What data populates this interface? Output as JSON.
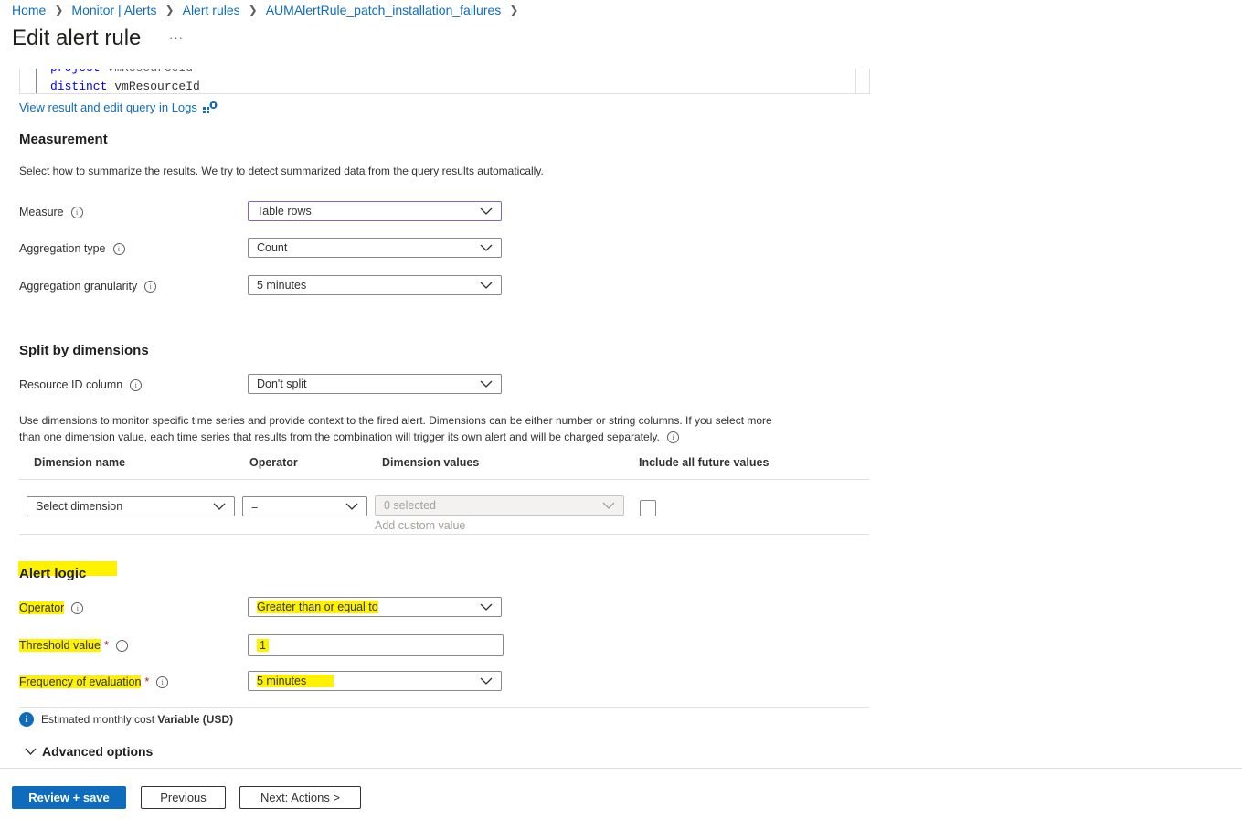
{
  "breadcrumb": {
    "items": [
      "Home",
      "Monitor | Alerts",
      "Alert rules",
      "AUMAlertRule_patch_installation_failures"
    ]
  },
  "page": {
    "title": "Edit alert rule",
    "more": "···"
  },
  "query": {
    "line1_kw": "project",
    "line1_rest": " vmResourceId",
    "line2_kw": "distinct",
    "line2_rest": " vmResourceId",
    "view_logs_link": "View result and edit query in Logs"
  },
  "measurement": {
    "heading": "Measurement",
    "description": "Select how to summarize the results. We try to detect summarized data from the query results automatically.",
    "measure": {
      "label": "Measure",
      "value": "Table rows"
    },
    "aggregation_type": {
      "label": "Aggregation type",
      "value": "Count"
    },
    "aggregation_granularity": {
      "label": "Aggregation granularity",
      "value": "5 minutes"
    }
  },
  "split": {
    "heading": "Split by dimensions",
    "resource_id": {
      "label": "Resource ID column",
      "value": "Don't split"
    },
    "description_line1": "Use dimensions to monitor specific time series and provide context to the fired alert. Dimensions can be either number or string columns. If you select more",
    "description_line2": "than one dimension value, each time series that results from the combination will trigger its own alert and will be charged separately.",
    "table": {
      "headers": [
        "Dimension name",
        "Operator",
        "Dimension values",
        "Include all future values"
      ],
      "row": {
        "dimension": "Select dimension",
        "operator": "=",
        "values": "0 selected",
        "add_custom": "Add custom value",
        "include_future": false
      }
    }
  },
  "alert_logic": {
    "heading": "Alert logic",
    "operator": {
      "label": "Operator",
      "value": "Greater than or equal to"
    },
    "threshold": {
      "label": "Threshold value",
      "required": "*",
      "value": "1"
    },
    "frequency": {
      "label": "Frequency of evaluation",
      "required": "*",
      "value": "5 minutes"
    }
  },
  "cost": {
    "icon": "i",
    "label": "Estimated monthly cost",
    "value": "Variable (USD)"
  },
  "advanced": {
    "label": "Advanced options"
  },
  "footer": {
    "review_save": "Review + save",
    "previous": "Previous",
    "next": "Next: Actions >"
  },
  "colors": {
    "accent": "#0f6cbd",
    "highlight": "#fff200",
    "required": "#a4262c"
  }
}
